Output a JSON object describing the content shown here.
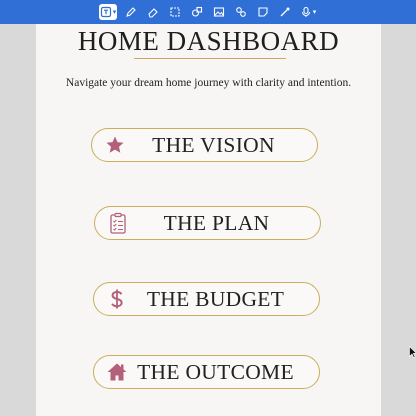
{
  "toolbar": {
    "tools": [
      {
        "name": "text-box-tool-icon",
        "active": true
      },
      {
        "name": "pen-tool-icon"
      },
      {
        "name": "eraser-tool-icon"
      },
      {
        "name": "lasso-tool-icon"
      },
      {
        "name": "shapes-tool-icon"
      },
      {
        "name": "image-tool-icon"
      },
      {
        "name": "sticker-tool-icon"
      },
      {
        "name": "sticky-note-tool-icon"
      },
      {
        "name": "laser-pointer-tool-icon"
      },
      {
        "name": "audio-tool-icon"
      }
    ],
    "accent": "#2f6fd6"
  },
  "page": {
    "title": "HOME DASHBOARD",
    "subtitle": "Navigate your dream home journey with clarity and intention."
  },
  "buttons": [
    {
      "label": "THE VISION",
      "icon": "star-icon"
    },
    {
      "label": "THE PLAN",
      "icon": "clipboard-checklist-icon"
    },
    {
      "label": "THE BUDGET",
      "icon": "dollar-sign-icon"
    },
    {
      "label": "THE OUTCOME",
      "icon": "house-icon"
    }
  ],
  "colors": {
    "pill_border": "#c9ae5c",
    "icon_rose": "#b5607a",
    "page_bg": "#f7f6f4"
  }
}
